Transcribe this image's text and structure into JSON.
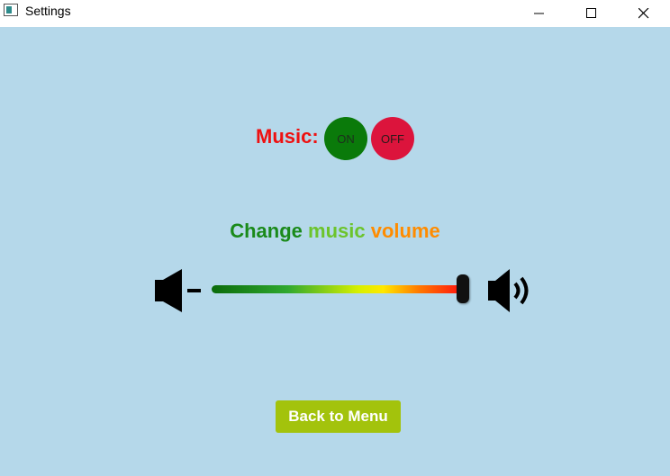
{
  "window": {
    "title": "Settings",
    "controls": [
      "minimize-icon",
      "maximize-icon",
      "close-icon"
    ]
  },
  "music": {
    "label": "Music:",
    "on_label": "ON",
    "off_label": "OFF",
    "on_color": "#0a7a0a",
    "off_color": "#dc143c"
  },
  "volume": {
    "title": "Change music volume",
    "title_colors": [
      "#1a8a1a",
      "#6cc42c",
      "#ff8c00",
      "#ee1111"
    ],
    "level": 1.0,
    "min_icon": "volume-down-icon",
    "max_icon": "volume-up-icon"
  },
  "back_button": {
    "label": "Back to Menu",
    "color": "#a3c30c"
  },
  "colors": {
    "background": "#b5d8ea",
    "music_label": "#ee1111"
  }
}
